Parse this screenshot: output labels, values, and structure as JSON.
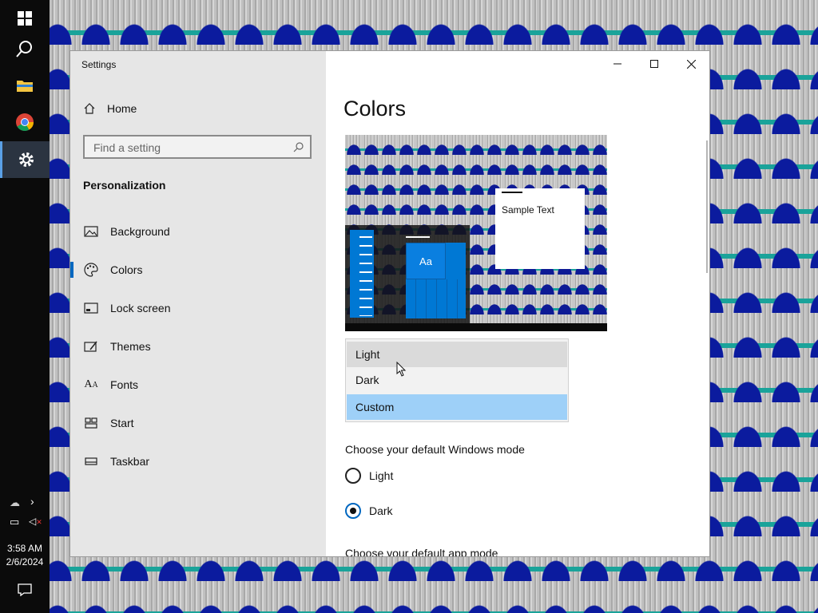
{
  "taskbar": {
    "time": "3:58 AM",
    "date": "2/6/2024"
  },
  "window": {
    "title": "Settings",
    "sidebar": {
      "home_label": "Home",
      "search_placeholder": "Find a setting",
      "section_title": "Personalization",
      "items": [
        {
          "label": "Background",
          "icon": "image-icon"
        },
        {
          "label": "Colors",
          "icon": "palette-icon"
        },
        {
          "label": "Lock screen",
          "icon": "lock-screen-icon"
        },
        {
          "label": "Themes",
          "icon": "themes-icon"
        },
        {
          "label": "Fonts",
          "icon": "fonts-icon"
        },
        {
          "label": "Start",
          "icon": "start-icon"
        },
        {
          "label": "Taskbar",
          "icon": "taskbar-icon"
        }
      ],
      "selected_item": "Colors"
    },
    "main": {
      "title": "Colors",
      "preview": {
        "tile_label": "Aa",
        "sample_text": "Sample Text"
      },
      "color_dropdown": {
        "options": [
          "Light",
          "Dark",
          "Custom"
        ],
        "selected": "Custom",
        "hovered": "Light"
      },
      "windows_mode": {
        "label": "Choose your default Windows mode",
        "options": [
          "Light",
          "Dark"
        ],
        "selected": "Dark"
      },
      "app_mode": {
        "label": "Choose your default app mode"
      }
    }
  },
  "colors": {
    "accent": "#0067c0",
    "dropdown_selected": "#9ed0f8",
    "tile_blue": "#0078d4"
  }
}
